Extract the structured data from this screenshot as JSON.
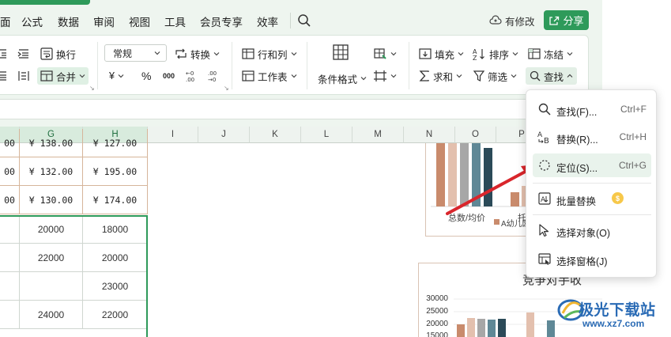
{
  "menu": {
    "items": [
      "面",
      "公式",
      "数据",
      "审阅",
      "视图",
      "工具",
      "会员专享",
      "效率"
    ],
    "modify_label": "有修改",
    "share_label": "分享"
  },
  "ribbon": {
    "wrap_label": "换行",
    "merge_label": "合并",
    "format_value": "常规",
    "convert_label": "转换",
    "percent_symbol": "%",
    "thousands_symbol": "000",
    "currency_symbol": "¥",
    "rowcol_label": "行和列",
    "worksheet_label": "工作表",
    "cond_format_label": "条件格式",
    "fill_label": "填充",
    "sort_label": "排序",
    "freeze_label": "冻结",
    "sum_label": "求和",
    "filter_label": "筛选",
    "find_label": "查找"
  },
  "columns": [
    "G",
    "H",
    "I",
    "J",
    "K",
    "L",
    "M",
    "N",
    "O",
    "P"
  ],
  "table": {
    "rows": [
      [
        "00",
        "¥ 138.00",
        "¥ 127.00"
      ],
      [
        "00",
        "¥ 132.00",
        "¥ 195.00"
      ],
      [
        "00",
        "¥ 130.00",
        "¥ 174.00"
      ],
      [
        "",
        "20000",
        "18000"
      ],
      [
        "",
        "22000",
        "20000"
      ],
      [
        "",
        "",
        "23000"
      ],
      [
        "",
        "24000",
        "22000"
      ]
    ]
  },
  "chart1": {
    "xlabel": "总数/均价",
    "legend": "A幼儿园",
    "side_text": "托"
  },
  "chart2": {
    "title": "竞争对手收",
    "ticks": [
      "30000",
      "25000",
      "20000",
      "15000"
    ]
  },
  "dropdown": {
    "items": [
      {
        "label": "查找(F)...",
        "shortcut": "Ctrl+F"
      },
      {
        "label": "替换(R)...",
        "shortcut": "Ctrl+H"
      },
      {
        "label": "定位(S)...",
        "shortcut": "Ctrl+G"
      },
      {
        "label": "批量替换",
        "shortcut": ""
      },
      {
        "label": "选择对象(O)",
        "shortcut": ""
      },
      {
        "label": "选择窗格(J)",
        "shortcut": ""
      }
    ],
    "vip_badge": "$"
  },
  "watermark": {
    "name": "极光下载站",
    "url": "www.xz7.com"
  },
  "colors": {
    "accent": "#2e9a5a",
    "bar_palette": [
      "#c98b6c",
      "#e3c0ae",
      "#a7a7a7",
      "#5f8896",
      "#2b4a58"
    ]
  }
}
